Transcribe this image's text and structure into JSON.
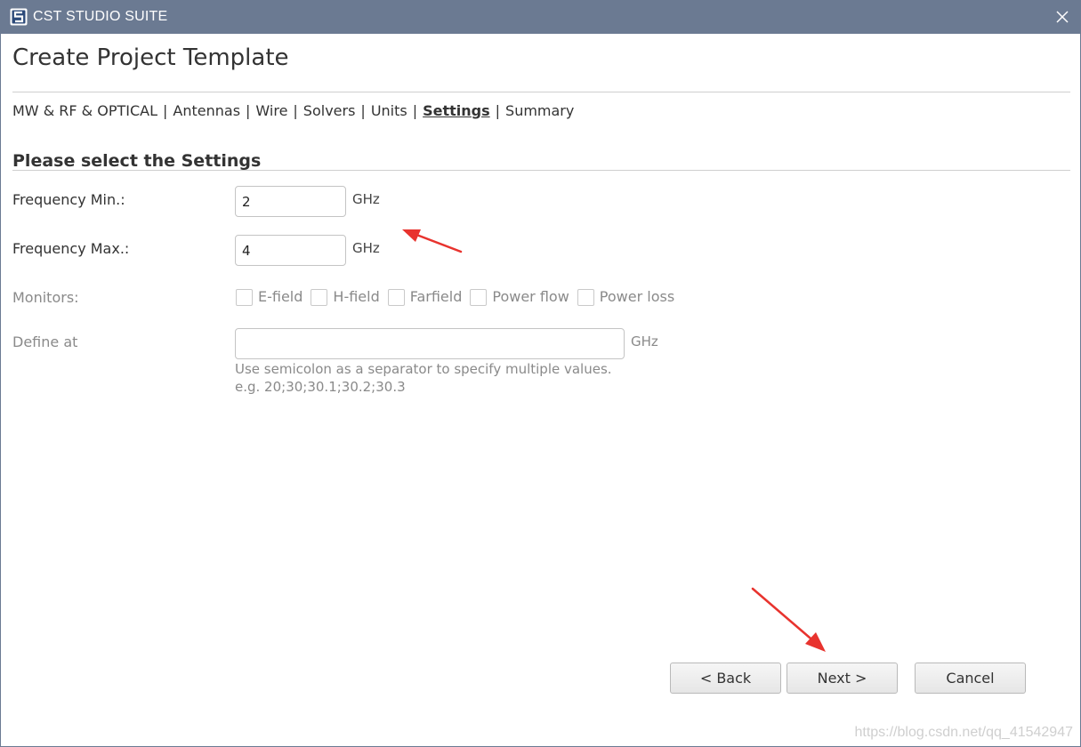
{
  "window": {
    "title": "CST STUDIO SUITE",
    "app_icon": "cst-logo-icon",
    "close_icon": "close-icon"
  },
  "page": {
    "title": "Create Project Template"
  },
  "breadcrumb": {
    "items": [
      {
        "label": "MW & RF & OPTICAL",
        "active": false
      },
      {
        "label": "Antennas",
        "active": false
      },
      {
        "label": "Wire",
        "active": false
      },
      {
        "label": "Solvers",
        "active": false
      },
      {
        "label": "Units",
        "active": false
      },
      {
        "label": "Settings",
        "active": true
      },
      {
        "label": "Summary",
        "active": false
      }
    ],
    "separator": "|"
  },
  "section": {
    "title": "Please select the Settings"
  },
  "form": {
    "freq_min": {
      "label": "Frequency Min.:",
      "value": "2",
      "unit": "GHz"
    },
    "freq_max": {
      "label": "Frequency Max.:",
      "value": "4",
      "unit": "GHz"
    },
    "monitors": {
      "label": "Monitors:",
      "options": [
        {
          "label": "E-field",
          "checked": false
        },
        {
          "label": "H-field",
          "checked": false
        },
        {
          "label": "Farfield",
          "checked": false
        },
        {
          "label": "Power flow",
          "checked": false
        },
        {
          "label": "Power loss",
          "checked": false
        }
      ]
    },
    "define_at": {
      "label": "Define at",
      "value": "",
      "unit": "GHz",
      "hint_line1": "Use semicolon as a separator to specify multiple values.",
      "hint_line2": "e.g. 20;30;30.1;30.2;30.3"
    }
  },
  "buttons": {
    "back": "< Back",
    "next": "Next >",
    "cancel": "Cancel"
  },
  "watermark": "https://blog.csdn.net/qq_41542947",
  "colors": {
    "titlebar": "#6b7a92",
    "annotation_arrow": "#e8332e",
    "disabled_text": "#8a8a8a"
  }
}
